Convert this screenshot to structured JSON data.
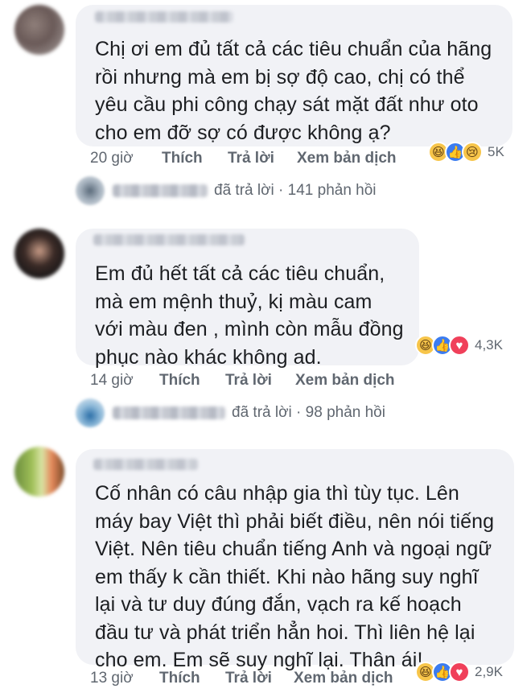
{
  "comments": [
    {
      "text": "Chị ơi em đủ tất cả các tiêu chuẩn của hãng\nrồi nhưng mà em bị sợ độ cao, chị có thể\nyêu cầu phi công chạy sát mặt đất như oto\ncho em đỡ sợ có được không ạ?",
      "time": "20 giờ",
      "like_label": "Thích",
      "reply_label": "Trả lời",
      "translate_label": "Xem bản dịch",
      "reactions": [
        "haha-icon",
        "like-icon",
        "sad-icon"
      ],
      "reaction_count": "5K",
      "replied_text": "đã trả lời · 141 phản hồi"
    },
    {
      "text": "Em đủ hết tất cả các tiêu chuẩn,\nmà em mệnh thuỷ, kị màu cam\nvới màu đen , mình còn mẫu đồng\nphục nào khác không ad.",
      "time": "14 giờ",
      "like_label": "Thích",
      "reply_label": "Trả lời",
      "translate_label": "Xem bản dịch",
      "reactions": [
        "haha-icon",
        "like-icon",
        "love-icon"
      ],
      "reaction_count": "4,3K",
      "replied_text": "đã trả lời · 98 phản hồi"
    },
    {
      "text": "Cố nhân có câu nhập gia thì tùy tục. Lên\nmáy bay Việt thì phải biết điều, nên nói tiếng\nViệt. Nên tiêu chuẩn tiếng Anh và ngoại ngữ\nem thấy k cần thiết. Khi nào hãng suy nghĩ\nlại và tư duy đúng đắn, vạch ra kế hoạch\nđầu tư và phát triển hẳn hoi. Thì liên hệ lại\ncho em. Em sẽ suy nghĩ lại. Thân ái!",
      "time": "13 giờ",
      "like_label": "Thích",
      "reply_label": "Trả lời",
      "translate_label": "Xem bản dịch",
      "reactions": [
        "haha-icon",
        "like-icon",
        "love-icon"
      ],
      "reaction_count": "2,9K"
    }
  ],
  "colors": {
    "bubble": "#f1f2f6",
    "meta_text": "#606770",
    "like_blue": "#3b7cf0",
    "haha_yellow": "#f7c54a",
    "love_red": "#f0405a"
  }
}
